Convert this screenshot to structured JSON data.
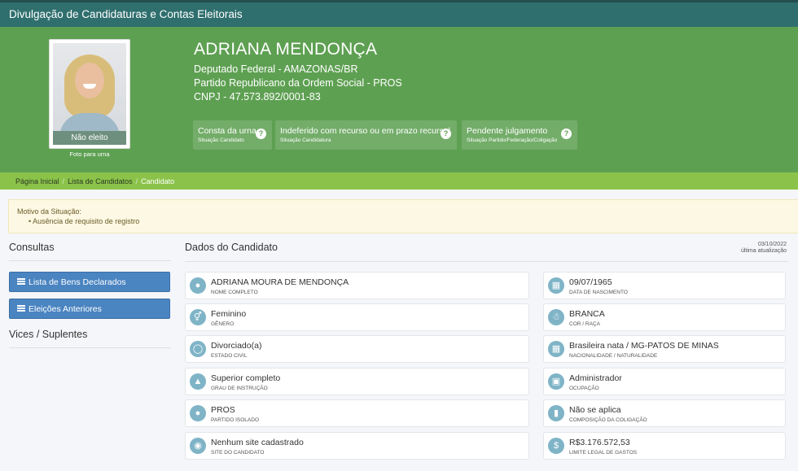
{
  "app": {
    "title": "Divulgação de Candidaturas e Contas Eleitorais"
  },
  "candidate": {
    "name": "ADRIANA MENDONÇA",
    "office": "Deputado Federal - AMAZONAS/BR",
    "party": "Partido Republicano da Ordem Social - PROS",
    "cnpj": "CNPJ - 47.573.892/0001-83",
    "photo_status": "Não eleito",
    "photo_label": "Foto para urna"
  },
  "statuses": [
    {
      "title": "Consta da urna",
      "subtitle": "Situação Candidato"
    },
    {
      "title": "Indeferido com recurso ou em prazo recursal",
      "subtitle": "Situação Candidatura"
    },
    {
      "title": "Pendente julgamento",
      "subtitle": "Situação Partido/Federação/Coligação"
    }
  ],
  "help_glyph": "?",
  "breadcrumb": {
    "home": "Página Inicial",
    "list": "Lista de Candidatos",
    "current": "Candidato",
    "separator": "/"
  },
  "alert": {
    "title": "Motivo da Situação:",
    "items": [
      "Ausência de requisito de registro"
    ]
  },
  "sidebar": {
    "heading": "Consultas",
    "buttons": [
      "Lista de Bens Declarados",
      "Eleições Anteriores"
    ],
    "vices": "Vices / Suplentes"
  },
  "main": {
    "heading": "Dados do Candidato",
    "update_date": "03/10/2022",
    "update_label": "última atualização"
  },
  "fields": [
    {
      "value": "ADRIANA MOURA DE MENDONÇA",
      "label": "Nome completo",
      "icon": "user-icon"
    },
    {
      "value": "09/07/1965",
      "label": "Data de nascimento",
      "icon": "calendar-icon"
    },
    {
      "value": "Feminino",
      "label": "Gênero",
      "icon": "gender-icon"
    },
    {
      "value": "BRANCA",
      "label": "Cor / Raça",
      "icon": "person-icon"
    },
    {
      "value": "Divorciado(a)",
      "label": "Estado civil",
      "icon": "ring-icon"
    },
    {
      "value": "Brasileira nata / MG-PATOS DE MINAS",
      "label": "Nacionalidade / Naturalidade",
      "icon": "map-icon"
    },
    {
      "value": "Superior completo",
      "label": "Grau de instrução",
      "icon": "graduation-cap-icon"
    },
    {
      "value": "Administrador",
      "label": "Ocupação",
      "icon": "building-icon"
    },
    {
      "value": "PROS",
      "label": "Partido isolado",
      "icon": "group-icon"
    },
    {
      "value": "Não se aplica",
      "label": "Composição da coligação",
      "icon": "folder-icon"
    },
    {
      "value": "Nenhum site cadastrado",
      "label": "Site do candidato",
      "icon": "globe-icon"
    },
    {
      "value": "R$3.176.572,53",
      "label": "Limite legal de gastos",
      "icon": "dollar-icon"
    }
  ],
  "colors": {
    "header": "#2f6f6e",
    "hero": "#5ea052",
    "breadcrumb": "#8bc34a",
    "button": "#4a84c1",
    "icon_circle": "#7fb4c7"
  }
}
